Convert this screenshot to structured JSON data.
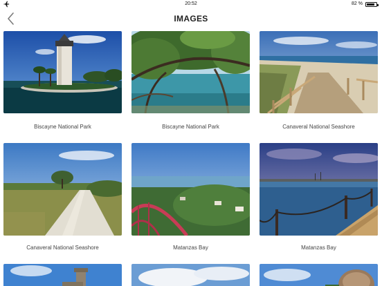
{
  "status_bar": {
    "time": "20:52",
    "battery": "82 %",
    "battery_level": 0.82,
    "left_icon": "airplane-icon"
  },
  "nav": {
    "title": "IMAGES",
    "back_icon": "chevron-left-icon"
  },
  "gallery": {
    "items": [
      {
        "caption": "Biscayne National Park"
      },
      {
        "caption": "Biscayne National Park"
      },
      {
        "caption": "Canaveral National Seashore"
      },
      {
        "caption": "Canaveral National Seashore"
      },
      {
        "caption": "Matanzas Bay"
      },
      {
        "caption": "Matanzas Bay"
      },
      {
        "caption": ""
      },
      {
        "caption": ""
      },
      {
        "caption": ""
      }
    ]
  }
}
